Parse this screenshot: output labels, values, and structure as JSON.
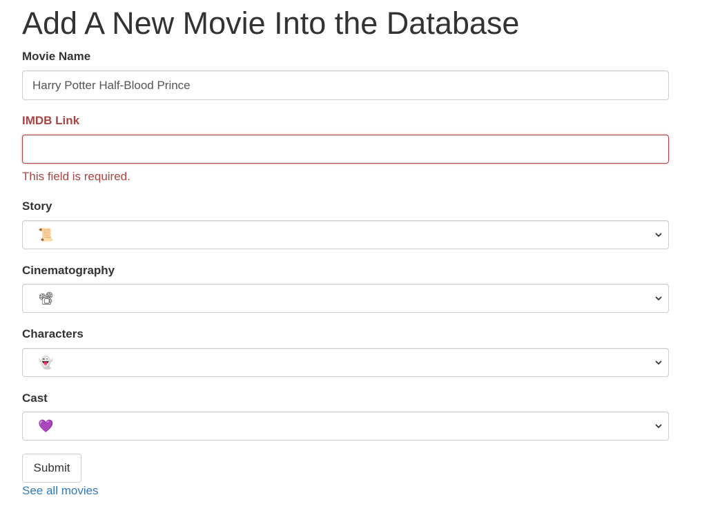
{
  "page": {
    "title": "Add A New Movie Into the Database"
  },
  "form": {
    "movie_name": {
      "label": "Movie Name",
      "value": "Harry Potter Half-Blood Prince"
    },
    "imdb_link": {
      "label": "IMDB Link",
      "value": "",
      "error": "This field is required."
    },
    "story": {
      "label": "Story",
      "selected": "📜"
    },
    "cinematography": {
      "label": "Cinematography",
      "selected": "📽"
    },
    "characters": {
      "label": "Characters",
      "selected": "👻"
    },
    "cast": {
      "label": "Cast",
      "selected": "💜"
    },
    "submit_label": "Submit"
  },
  "links": {
    "see_all": "See all movies"
  },
  "colors": {
    "error": "#a94442",
    "link": "#337ab7",
    "text": "#333333",
    "border": "#cccccc"
  },
  "icons": {
    "select_arrow": "chevron-down-icon"
  }
}
